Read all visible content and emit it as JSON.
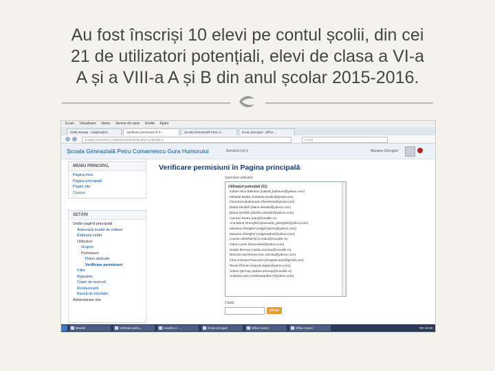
{
  "slide": {
    "title_lines": [
      "Au fost înscriși 10 elevi pe contul școlii, din cei",
      "21 de utilizatori potențiali,  elevi de clasa a VI-a",
      "A și a VIII-a A și B din anul școlar 2015-2016."
    ]
  },
  "browser": {
    "menu": [
      "Ecran",
      "Vizualizare",
      "Istoric",
      "Semne de carte",
      "Unelte",
      "Ajutor"
    ],
    "tabs": [
      "(199) Mesaje - mdgherghel...",
      "Verificare permisiuni în P...",
      "Școala Gimnazială Petru C...",
      "Ecran principal - Office..."
    ],
    "address": "scoalacomarnescu.ro/admin/roles/check.php?contextid=2",
    "search_placeholder": "Caută"
  },
  "site": {
    "name": "Școala Gimnazială Petru Comarnescu Gura Humorului",
    "language": "Română (ro) ▾",
    "user": "Mariana Gherghel"
  },
  "sidebar": {
    "main_menu_title": "MENIU PRINCIPAL",
    "main_menu_items": [
      "Pagina mea",
      "Pagina principală",
      "Pagini site",
      "Cursuri"
    ],
    "settings_title": "SETĂRI",
    "settings_items": [
      "Setări pagină principală",
      "Activează modul de editare",
      "Editează setări",
      "Utilizatori",
      "Grupuri",
      "Permisiuni",
      "Roluri atribuite",
      "Verificare permisiuni",
      "Filtre",
      "Rapoarte",
      "Copie de rezervă",
      "Restaurează",
      "Bancă de întrebări",
      "Administrare site"
    ]
  },
  "main": {
    "title": "Verificare permisiuni în Pagina principală",
    "select_label": "Selectare utilizator",
    "list_header": "Utilizatori potențiali (21)",
    "users": [
      "Isabel-Alice Balintoni (isabell_balintoni@yahoo.com)",
      "Mihaela Bodan (mihaela.bodan@gmail.com)",
      "Florentina Buleanuan (florentina@gmail.com)",
      "Diana Devidel (diana.devidel@yahoo.com)",
      "Diana Devidel (dumitru.devidel@yahoo.com)",
      "Carmen Esaru (edu@moodle.ro)",
      "Ana Maria Gherghel (anamaria_gherghel@yahoo.com)",
      "Mariana Gherghel (mdgherghel1@yahoo.com)",
      "Mariana Gherghel (mdgherghel@yahoo.com)",
      "Cosmin IEORMAN (contact@moodle.ro)",
      "Oana Lucan (lucanoana@yahoo.com)",
      "Ovidiu Moroșu (ovidiu.morosu@moodle.ro)",
      "Narcisa Nechiforea (nec.narcisa@yahoo.com)",
      "Irina Andreea Pascovici (irinapascovici@gmail.com)",
      "Teona Pînzari (educat.impex@yahoo.com)",
      "Adrian Știrmay (adrian.stirmay@moodle.ro)",
      "Andreea Ivan (Andreeaandrei7@yahoo.com)"
    ],
    "find_label": "Caută",
    "find_button": "Șterge"
  },
  "taskbar": {
    "items": [
      "Moodle",
      "Verificare perm...",
      "moodle.ro - ...",
      "Ecran principal",
      "Office Center",
      "Office Center"
    ],
    "clock": "RO 10:49"
  }
}
